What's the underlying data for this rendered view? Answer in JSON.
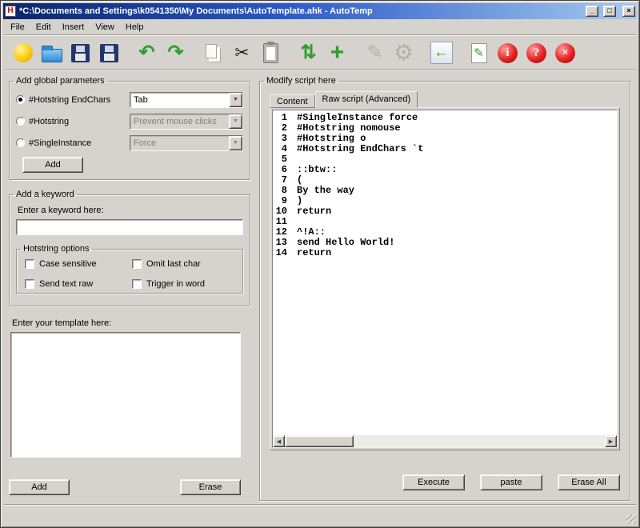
{
  "window": {
    "title": "*C:\\Documents and Settings\\k0541350\\My Documents\\AutoTemplate.ahk - AutoTemp",
    "app_icon_letter": "H",
    "controls": {
      "minimize": "_",
      "maximize": "□",
      "close": "×"
    }
  },
  "menu": {
    "items": [
      "File",
      "Edit",
      "Insert",
      "View",
      "Help"
    ]
  },
  "icons": {
    "chevron_down": "▼",
    "scroll_left": "◀",
    "scroll_right": "▶"
  },
  "toolbar": {
    "icons": [
      {
        "name": "new-icon",
        "cls": "ic-ball"
      },
      {
        "name": "open-folder-icon",
        "cls": "ic-folder"
      },
      {
        "name": "save-icon",
        "cls": "ic-floppy"
      },
      {
        "name": "save-as-icon",
        "cls": "ic-floppy"
      },
      {
        "sep": true
      },
      {
        "name": "undo-icon",
        "glyph": "↶",
        "cls": "ic-green"
      },
      {
        "name": "redo-icon",
        "glyph": "↷",
        "cls": "ic-green"
      },
      {
        "sep": true
      },
      {
        "name": "copy-icon",
        "cls": "ic-copy"
      },
      {
        "name": "cut-icon",
        "glyph": "✂",
        "cls": "ic-dark"
      },
      {
        "name": "paste-icon",
        "cls": "ic-clipboard"
      },
      {
        "sep": true
      },
      {
        "name": "refresh-icon",
        "glyph": "⇅",
        "cls": "ic-green"
      },
      {
        "name": "add-icon",
        "glyph": "+",
        "cls": "ic-green ic-plus"
      },
      {
        "sep": true
      },
      {
        "name": "edit-icon",
        "glyph": "✎",
        "cls": "ic-gray"
      },
      {
        "name": "settings-gear-icon",
        "glyph": "⚙",
        "cls": "ic-gray ic-big"
      },
      {
        "sep": true
      },
      {
        "name": "back-arrow-icon",
        "glyph": "←",
        "cls": "ic-boxed"
      },
      {
        "sep": true
      },
      {
        "name": "modify-script-icon",
        "glyph": "✎",
        "cls": "ic-page-pencil"
      },
      {
        "name": "info-icon",
        "glyph": "i",
        "cls": "ic-redcircle"
      },
      {
        "name": "help-icon",
        "glyph": "?",
        "cls": "ic-redcircle"
      },
      {
        "name": "exit-icon",
        "glyph": "×",
        "cls": "ic-redcircle"
      }
    ]
  },
  "left": {
    "global_params": {
      "legend": "Add global parameters",
      "rows": [
        {
          "radio": "#Hotstring EndChars",
          "checked": true,
          "value": "Tab",
          "enabled": true
        },
        {
          "radio": "#Hotstring",
          "checked": false,
          "value": "Prevent mouse clicks",
          "enabled": false
        },
        {
          "radio": "#SingleInstance",
          "checked": false,
          "value": "Force",
          "enabled": false
        }
      ],
      "add_label": "Add"
    },
    "keyword": {
      "legend": "Add a keyword",
      "label": "Enter a keyword here:",
      "value": "",
      "options": {
        "legend": "Hotstring options",
        "checkboxes": [
          {
            "label": "Case sensitive",
            "checked": false
          },
          {
            "label": "Omit last char",
            "checked": false
          },
          {
            "label": "Send text raw",
            "checked": false
          },
          {
            "label": "Trigger in word",
            "checked": false
          }
        ]
      }
    },
    "template": {
      "label": "Enter your template here:",
      "value": "",
      "add_label": "Add",
      "erase_label": "Erase"
    }
  },
  "right": {
    "legend": "Modify script here",
    "tabs": [
      {
        "label": "Content",
        "active": false
      },
      {
        "label": "Raw script (Advanced)",
        "active": true
      }
    ],
    "editor": {
      "lines": [
        "#SingleInstance force",
        "#Hotstring nomouse",
        "#Hotstring o",
        "#Hotstring EndChars `t",
        "",
        "::btw::",
        "(",
        "By the way",
        ")",
        "return",
        "",
        "^!A::",
        "send Hello World!",
        "return"
      ]
    },
    "buttons": [
      "Execute",
      "paste",
      "Erase All"
    ]
  }
}
